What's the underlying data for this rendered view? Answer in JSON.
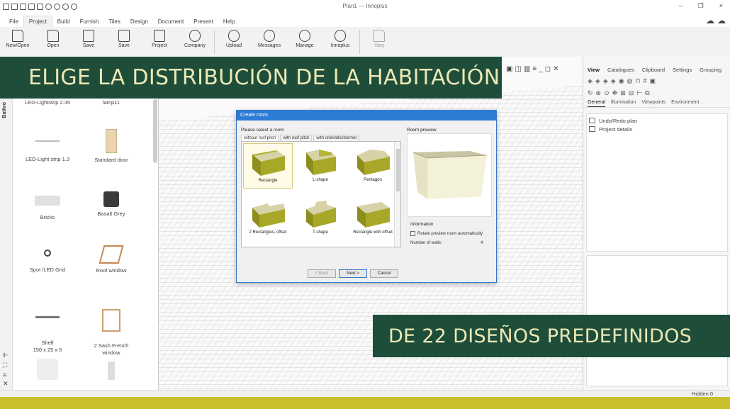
{
  "window": {
    "title": "Plan1 — Innoplus",
    "controls": [
      "–",
      "❐",
      "×"
    ]
  },
  "menu": {
    "tabs": [
      "File",
      "Project",
      "Build",
      "Furnish",
      "Tiles",
      "Design",
      "Document",
      "Present",
      "Help"
    ],
    "active": "Project"
  },
  "ribbon": {
    "buttons": [
      {
        "label": "New/Open",
        "icon": "new-file-icon"
      },
      {
        "label": "Open",
        "icon": "open-icon"
      },
      {
        "label": "Save",
        "icon": "save-icon"
      },
      {
        "label": "Save",
        "icon": "save-as-icon"
      },
      {
        "label": "Project",
        "icon": "project-details-icon"
      },
      {
        "label": "Company",
        "icon": "company-icon"
      },
      {
        "label": "Upload",
        "icon": "upload-cloud-icon"
      },
      {
        "label": "Messages",
        "icon": "messages-cloud-icon"
      },
      {
        "label": "Manage",
        "icon": "manage-cloud-icon"
      },
      {
        "label": "Innoplus",
        "icon": "innoplus-cloud-icon"
      },
      {
        "label": "Vary",
        "icon": "vary-icon",
        "disabled": true
      }
    ]
  },
  "leftstrip": {
    "label": "Bathro"
  },
  "catalog": {
    "items": [
      {
        "label": "LED-Lightstrip 2.35"
      },
      {
        "label": "lamp11"
      },
      {
        "label": "LED-Light strip 1.3"
      },
      {
        "label": "Standard door"
      },
      {
        "label": "Bricks"
      },
      {
        "label": "Basalt Grey"
      },
      {
        "label": "Spot /LED Grid"
      },
      {
        "label": "Roof window"
      },
      {
        "label": "Shelf\n150 x 25 x 5"
      },
      {
        "label": "2 Sash French\nwindow"
      }
    ]
  },
  "banners": {
    "top": "ELIGE LA DISTRIBUCIÓN DE LA HABITACIÓN",
    "bottom": "DE 22 DISEÑOS PREDEFINIDOS"
  },
  "right_panel": {
    "tabs": [
      "View",
      "Catalogues",
      "Clipboard",
      "Settings",
      "Grouping"
    ],
    "active_tab": "View",
    "subtabs": [
      "General",
      "Illumination",
      "Viewpoints",
      "Environment"
    ],
    "active_subtab": "General",
    "tree": [
      "Undo/Redo plan",
      "Project details"
    ]
  },
  "dialog": {
    "title": "Create room",
    "prompt": "Please select a room",
    "tabs": [
      "without roof pitch",
      "with roof pitch",
      "with oriel/attic/dormer"
    ],
    "active_tab": "without roof pitch",
    "shapes": [
      {
        "label": "Rectangle",
        "selected": true
      },
      {
        "label": "L-shape"
      },
      {
        "label": "Pentagon"
      },
      {
        "label": "2 Rectangles, offset"
      },
      {
        "label": "T-shape"
      },
      {
        "label": "Rectangle with offset"
      }
    ],
    "preview_label": "Room preview",
    "info_label": "Information",
    "rotate_label": "Rotate preview room automatically",
    "walls_label": "Number of walls:",
    "walls_value": "4",
    "buttons": {
      "back": "< Back",
      "next": "Next >",
      "cancel": "Cancel"
    }
  },
  "status": {
    "hidden": "Hidden 0"
  },
  "colors": {
    "banner_bg": "#1e4d3a",
    "banner_text": "#ece8b5",
    "room_olive": "#a8a828",
    "accent_blue": "#2e7bd6",
    "bottom_band": "#c7c02a"
  }
}
